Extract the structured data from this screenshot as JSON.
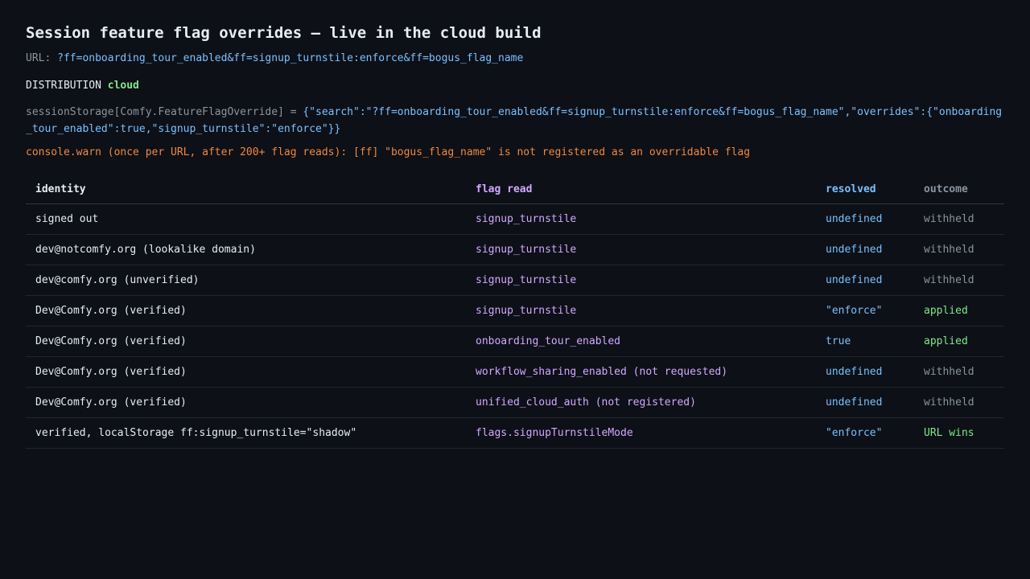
{
  "title": "Session feature flag overrides — live in the cloud build",
  "url": {
    "label": "URL:",
    "value": "?ff=onboarding_tour_enabled&ff=signup_turnstile:enforce&ff=bogus_flag_name"
  },
  "distribution": {
    "label": "DISTRIBUTION",
    "value": "cloud"
  },
  "session_storage": {
    "label": "sessionStorage[Comfy.FeatureFlagOverride] =",
    "value": "{\"search\":\"?ff=onboarding_tour_enabled&ff=signup_turnstile:enforce&ff=bogus_flag_name\",\"overrides\":{\"onboarding_tour_enabled\":true,\"signup_turnstile\":\"enforce\"}}"
  },
  "warning": "console.warn (once per URL, after 200+ flag reads): [ff] \"bogus_flag_name\" is not registered as an overridable flag",
  "table": {
    "headers": [
      "identity",
      "flag read",
      "resolved",
      "outcome"
    ],
    "rows": [
      {
        "identity": "signed out",
        "flag": "signup_turnstile",
        "resolved": "undefined",
        "outcome": "withheld"
      },
      {
        "identity": "dev@notcomfy.org (lookalike domain)",
        "flag": "signup_turnstile",
        "resolved": "undefined",
        "outcome": "withheld"
      },
      {
        "identity": "dev@comfy.org (unverified)",
        "flag": "signup_turnstile",
        "resolved": "undefined",
        "outcome": "withheld"
      },
      {
        "identity": "Dev@Comfy.org (verified)",
        "flag": "signup_turnstile",
        "resolved": "\"enforce\"",
        "outcome": "applied"
      },
      {
        "identity": "Dev@Comfy.org (verified)",
        "flag": "onboarding_tour_enabled",
        "resolved": "true",
        "outcome": "applied"
      },
      {
        "identity": "Dev@Comfy.org (verified)",
        "flag": "workflow_sharing_enabled (not requested)",
        "resolved": "undefined",
        "outcome": "withheld"
      },
      {
        "identity": "Dev@Comfy.org (verified)",
        "flag": "unified_cloud_auth (not registered)",
        "resolved": "undefined",
        "outcome": "withheld"
      },
      {
        "identity": "verified, localStorage ff:signup_turnstile=\"shadow\"",
        "flag": "flags.signupTurnstileMode",
        "resolved": "\"enforce\"",
        "outcome": "URL wins"
      }
    ]
  },
  "colors": {
    "background": "#0d1017",
    "text": "#e6edf3",
    "muted": "#8b949e",
    "value_blue": "#79c0ff",
    "flag_purple": "#d2a8ff",
    "success_green": "#7ee787",
    "warning_orange": "#f0883e"
  }
}
